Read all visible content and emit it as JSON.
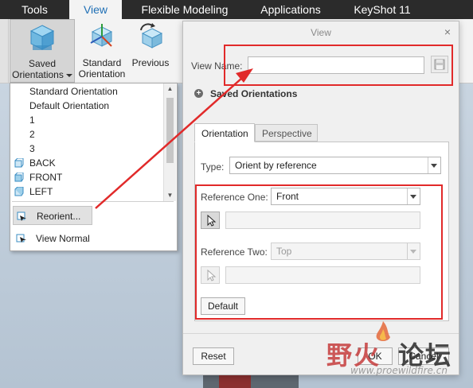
{
  "ribbon": {
    "tabs": [
      "Tools",
      "View",
      "Flexible Modeling",
      "Applications",
      "KeyShot 11"
    ],
    "active_tab": "View",
    "buttons": {
      "saved_orientations": "Saved\nOrientations",
      "standard_orientation": "Standard\nOrientation",
      "previous": "Previous"
    }
  },
  "orientation_menu": {
    "items": [
      "Standard Orientation",
      "Default Orientation",
      "1",
      "2",
      "3",
      "BACK",
      "FRONT",
      "LEFT"
    ],
    "reorient": "Reorient...",
    "view_normal": "View Normal"
  },
  "dialog": {
    "title": "View",
    "close_glyph": "×",
    "view_name_label": "View Name:",
    "view_name_value": "",
    "saved_orientations_label": "Saved Orientations",
    "tabs": [
      "Orientation",
      "Perspective"
    ],
    "active_tab": "Orientation",
    "type_label": "Type:",
    "type_value": "Orient by reference",
    "reference_one_label": "Reference One:",
    "reference_one_value": "Front",
    "reference_two_label": "Reference Two:",
    "reference_two_value": "Top",
    "default_button": "Default",
    "reset_button": "Reset",
    "ok_button": "OK",
    "cancel_button": "Cancel"
  },
  "watermark": {
    "text_red": "野火",
    "text_dark": "论坛",
    "url": "www.proewildfire.cn"
  },
  "colors": {
    "annotation_red": "#e12a2a",
    "tab_active_blue": "#1f6fb5"
  }
}
